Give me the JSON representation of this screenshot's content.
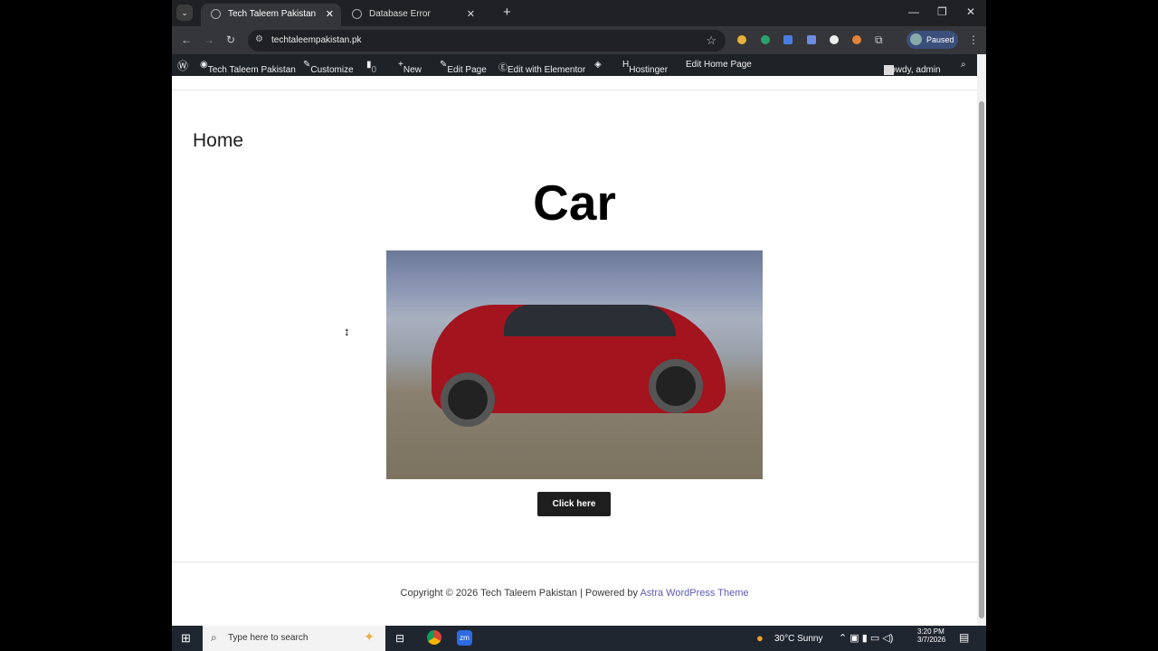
{
  "browser": {
    "tabs": [
      {
        "title": "Tech Taleem Pakistan",
        "active": true
      },
      {
        "title": "Database Error",
        "active": false
      }
    ],
    "url": "techtaleempakistan.pk",
    "profile_label": "Paused",
    "extension_colors": [
      "#e8b13a",
      "#2aa36a",
      "#4a7de0",
      "#6c8de0",
      "#eeeeee",
      "#e0843a",
      "#cccccc"
    ]
  },
  "wp_admin_bar": {
    "site_name": "Tech Taleem Pakistan",
    "customize": "Customize",
    "comments_count": "0",
    "new": "New",
    "edit_page": "Edit Page",
    "edit_elementor": "Edit with Elementor",
    "hostinger": "Hostinger",
    "edit_home": "Edit Home Page",
    "howdy": "Howdy, admin"
  },
  "page": {
    "title": "Home",
    "heading": "Car",
    "button_label": "Click here",
    "footer_text": "Copyright © 2026 Tech Taleem Pakistan | Powered by ",
    "footer_link": "Astra WordPress Theme"
  },
  "taskbar": {
    "search_placeholder": "Type here to search",
    "weather": "30°C  Sunny",
    "time": "3:20 PM",
    "date": "3/7/2026"
  }
}
